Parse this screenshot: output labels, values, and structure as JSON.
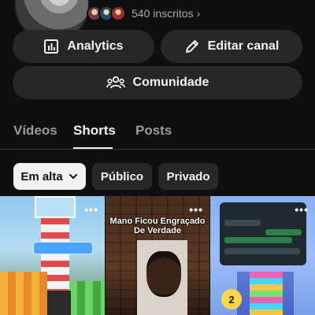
{
  "channel": {
    "subscribers_label": "540 inscritos",
    "subscribers_chevron": "›"
  },
  "actions": {
    "analytics_label": "Analytics",
    "edit_label": "Editar canal",
    "community_label": "Comunidade"
  },
  "tabs": [
    {
      "label": "Vídeos",
      "active": false
    },
    {
      "label": "Shorts",
      "active": true
    },
    {
      "label": "Posts",
      "active": false
    }
  ],
  "filters": {
    "sort_label": "Em alta",
    "public_label": "Público",
    "private_label": "Privado"
  },
  "shorts": [
    {
      "menu": "•••"
    },
    {
      "menu": "•••",
      "caption": "Mano Ficou Engraçado De Verdade"
    },
    {
      "menu": "•••",
      "badge": "2"
    }
  ],
  "icons": [
    "analytics-icon",
    "edit-pencil-icon",
    "community-icon",
    "chevron-down-icon",
    "more-icon"
  ]
}
